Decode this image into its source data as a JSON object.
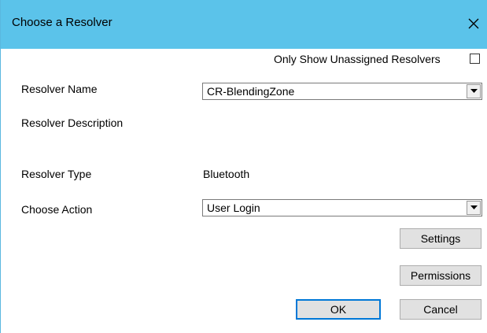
{
  "window": {
    "title": "Choose a Resolver"
  },
  "only_unassigned": {
    "label": "Only Show Unassigned Resolvers",
    "checked": false
  },
  "resolver_name": {
    "label": "Resolver Name",
    "value": "CR-BlendingZone"
  },
  "resolver_description": {
    "label": "Resolver Description"
  },
  "resolver_type": {
    "label": "Resolver Type",
    "value": "Bluetooth"
  },
  "choose_action": {
    "label": "Choose Action",
    "value": "User Login"
  },
  "buttons": {
    "settings": "Settings",
    "permissions": "Permissions",
    "ok": "OK",
    "cancel": "Cancel"
  },
  "colors": {
    "titlebar": "#5bc3ea",
    "button_face": "#e1e1e1",
    "default_border": "#0078d7"
  },
  "icons": {
    "close": "close-icon",
    "dropdown": "chevron-down-icon"
  }
}
